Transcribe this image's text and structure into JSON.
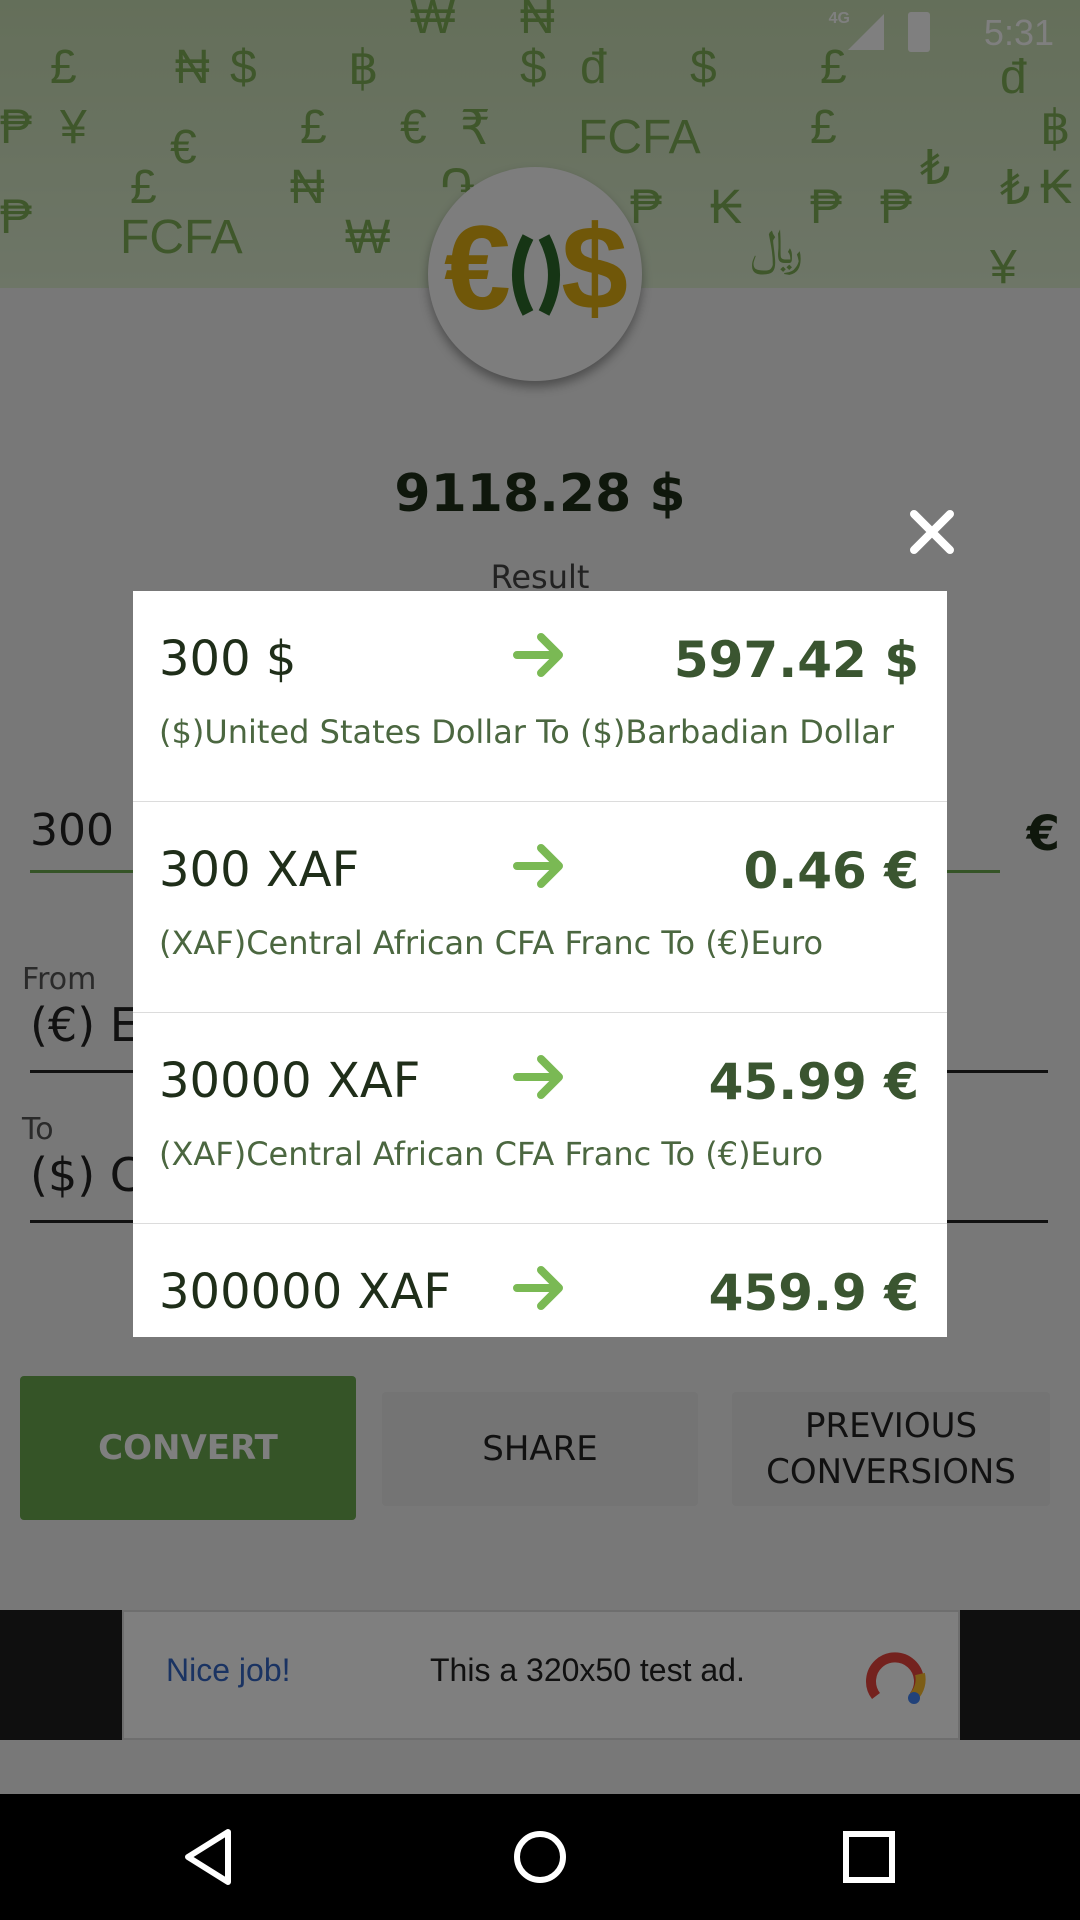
{
  "status_bar": {
    "time": "5:31",
    "network": "4G"
  },
  "banner": {
    "symbols": [
      "£",
      "₦",
      "$",
      "฿",
      "$",
      "đ",
      "$",
      "£",
      "₩",
      "₦",
      "₱",
      "¥",
      "€",
      "£",
      "€",
      "₹",
      "FCFA",
      "£",
      "฿",
      "£",
      "₦",
      "֏",
      "₺",
      "₱",
      "₭",
      "₺",
      "₱",
      "FCFA",
      "₩",
      "₱",
      "₭",
      "₱",
      "﷼",
      "¥",
      "đ"
    ]
  },
  "result": {
    "value": "9118.28 $",
    "label": "Result"
  },
  "amount": {
    "value": "300",
    "currency_symbol": "€"
  },
  "from": {
    "label": "From",
    "value": "(€) Eu"
  },
  "to": {
    "label": "To",
    "value": "($) C"
  },
  "buttons": {
    "convert": "CONVERT",
    "share": "SHARE",
    "previous": "PREVIOUS CONVERSIONS"
  },
  "ad": {
    "nice": "Nice job!",
    "text": "This a 320x50 test ad."
  },
  "dialog": {
    "rows": [
      {
        "amount": "300",
        "currency": "$",
        "result": "597.42 $",
        "desc": "($)United States Dollar  To  ($)Barbadian Dollar"
      },
      {
        "amount": "300",
        "currency": "XAF",
        "result": "0.46 €",
        "desc": "(XAF)Central African CFA Franc  To  (€)Euro"
      },
      {
        "amount": "30000",
        "currency": "XAF",
        "result": "45.99 €",
        "desc": "(XAF)Central African CFA Franc  To  (€)Euro"
      },
      {
        "amount": "300000",
        "currency": "XAF",
        "result": "459.9 €",
        "desc": ""
      }
    ]
  },
  "colors": {
    "accent": "#6aa84f",
    "dark_text": "#1f2e19",
    "arrow": "#7ab954"
  }
}
